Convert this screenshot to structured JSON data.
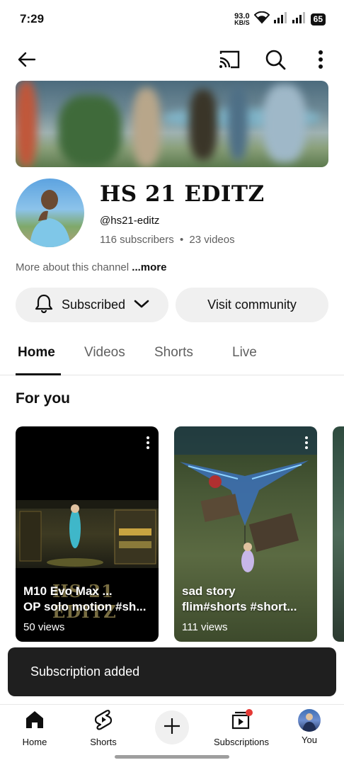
{
  "status_bar": {
    "time": "7:29",
    "net_speed_value": "93.0",
    "net_speed_unit": "KB/S",
    "battery": "65"
  },
  "top_bar": {
    "icons": [
      "back-arrow-icon",
      "cast-icon",
      "search-icon",
      "more-vert-icon"
    ]
  },
  "channel": {
    "name": "HS 21 EDITZ",
    "handle": "@hs21-editz",
    "subscribers": "116 subscribers",
    "separator": "•",
    "videos": "23 videos",
    "about_text": "More about this channel ",
    "about_more": "...more"
  },
  "actions": {
    "subscribed_label": "Subscribed",
    "community_label": "Visit community"
  },
  "tabs": [
    {
      "label": "Home",
      "active": true
    },
    {
      "label": "Videos",
      "active": false
    },
    {
      "label": "Shorts",
      "active": false
    },
    {
      "label": "Live",
      "active": false
    }
  ],
  "section": {
    "title": "For you"
  },
  "shorts": [
    {
      "title_line1": "M10 Evo Max ...",
      "title_line2": "OP solo motion #sh...",
      "views": "50 views",
      "watermark": "HS 21 EDITZ"
    },
    {
      "title_line1": "sad story",
      "title_line2": "flim#shorts #short...",
      "views": "111 views"
    }
  ],
  "snackbar": {
    "message": "Subscription added"
  },
  "bottom_nav": [
    {
      "label": "Home",
      "icon": "home-icon"
    },
    {
      "label": "Shorts",
      "icon": "shorts-icon"
    },
    {
      "label": "",
      "icon": "create-plus-icon"
    },
    {
      "label": "Subscriptions",
      "icon": "subscriptions-icon"
    },
    {
      "label": "You",
      "icon": "avatar"
    }
  ],
  "colors": {
    "text_primary": "#0f0f0f",
    "text_secondary": "#606060",
    "pill_bg": "#f0f0f0",
    "snackbar_bg": "#1f1f1f",
    "notification_dot": "#e53935"
  }
}
